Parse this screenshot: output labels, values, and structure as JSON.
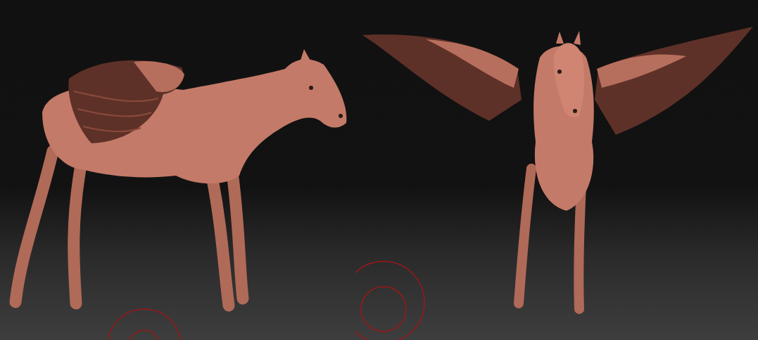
{
  "viewports": [
    {
      "kind": "side",
      "brush_cursor": true
    },
    {
      "kind": "front",
      "brush_cursor": true
    }
  ]
}
